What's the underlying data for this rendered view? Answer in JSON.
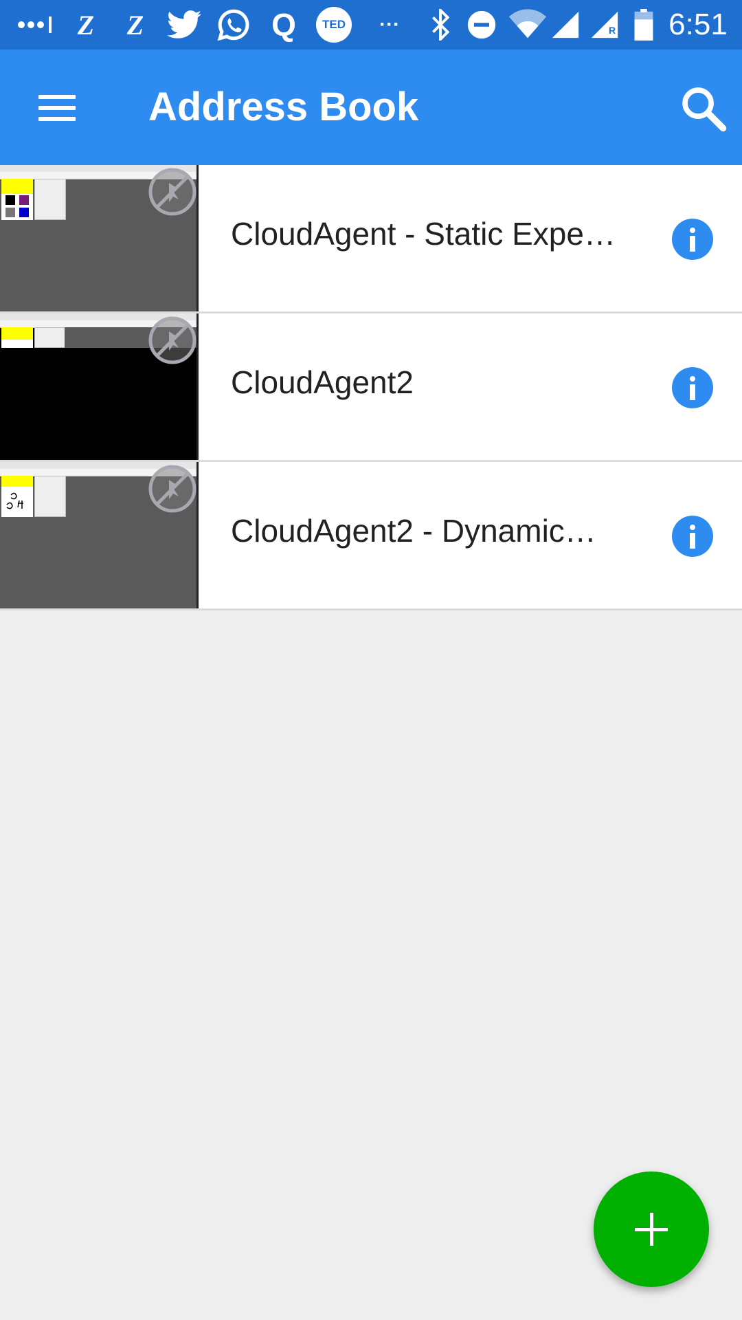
{
  "status_bar": {
    "time": "6:51",
    "icons": [
      "signal-dots-icon",
      "z-app-icon",
      "z-app-icon",
      "twitter-icon",
      "whatsapp-icon",
      "quora-icon",
      "ted-icon",
      "more-notifications-icon",
      "bluetooth-icon",
      "do-not-disturb-icon",
      "wifi-icon",
      "cell-signal-icon",
      "cell-signal-roaming-icon",
      "battery-icon"
    ],
    "glyphs": {
      "z": "Z",
      "quora": "Q",
      "ted": "TED",
      "more": "···",
      "roaming": "R"
    }
  },
  "toolbar": {
    "title": "Address Book",
    "menu_icon": "menu-icon",
    "search_icon": "search-icon"
  },
  "contacts": [
    {
      "name": "CloudAgent - Static Expe…",
      "thumbnail": "screen-preview",
      "muted": true
    },
    {
      "name": "CloudAgent2",
      "thumbnail": "screen-preview-dark",
      "muted": true
    },
    {
      "name": "CloudAgent2 - Dynamic…",
      "thumbnail": "screen-preview",
      "muted": true
    }
  ],
  "fab": {
    "icon": "add-icon"
  },
  "colors": {
    "status_bar": "#1f6fd1",
    "toolbar": "#2e8cf0",
    "info_button": "#2e8cf0",
    "fab": "#00b000",
    "background": "#eeeeee"
  }
}
